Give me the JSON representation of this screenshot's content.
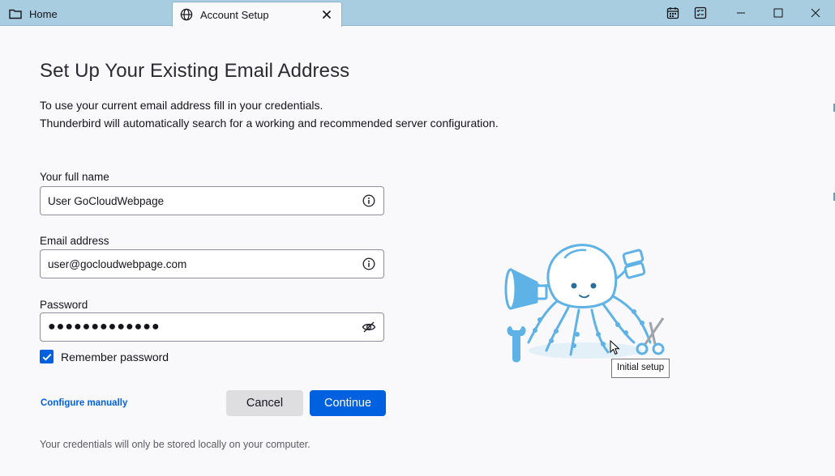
{
  "tabs": {
    "home_label": "Home",
    "setup_label": "Account Setup"
  },
  "page": {
    "title": "Set Up Your Existing Email Address",
    "intro_line1": "To use your current email address fill in your credentials.",
    "intro_line2": "Thunderbird will automatically search for a working and recommended server configuration."
  },
  "form": {
    "name_label": "Your full name",
    "name_value": "User GoCloudWebpage",
    "email_label": "Email address",
    "email_value": "user@gocloudwebpage.com",
    "password_label": "Password",
    "password_value": "●●●●●●●●●●●●●",
    "remember_label": "Remember password",
    "remember_checked": true
  },
  "actions": {
    "configure_manually": "Configure manually",
    "cancel": "Cancel",
    "continue": "Continue"
  },
  "footer": {
    "note": "Your credentials will only be stored locally on your computer."
  },
  "tooltip": {
    "text": "Initial setup"
  },
  "icons": {
    "home_tab": "folder-icon",
    "setup_tab": "globe-icon",
    "calendar": "calendar-icon",
    "tasks": "tasks-icon",
    "info": "info-icon",
    "hide_password": "eye-slash-icon"
  },
  "colors": {
    "accent": "#0061e0",
    "titlebar": "#a9cde0",
    "mascot": "#5fb2e6"
  }
}
